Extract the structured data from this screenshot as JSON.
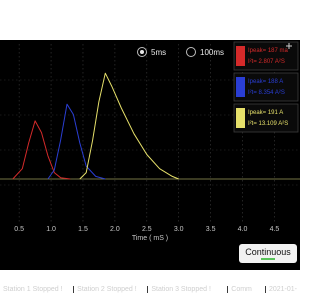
{
  "chart_data": {
    "type": "line",
    "xlabel": "Time ( mS )",
    "ylabel": "",
    "x_ticks": [
      0.5,
      1.0,
      1.5,
      2.0,
      2.5,
      3.0,
      3.5,
      4.0,
      4.5
    ],
    "x_tick_labels": [
      "0.5",
      "1.0",
      "1.5",
      "2.0",
      "2.5",
      "3.0",
      "3.5",
      "4.0",
      "4.5"
    ],
    "xlim": [
      0.2,
      4.9
    ],
    "grid": true,
    "series": [
      {
        "name": "red",
        "color": "#d42a2a",
        "x": [
          0.4,
          0.55,
          0.65,
          0.75,
          0.85,
          0.95,
          1.05,
          1.15,
          1.3
        ],
        "y": [
          0,
          0.08,
          0.28,
          0.45,
          0.36,
          0.18,
          0.05,
          0.01,
          0
        ]
      },
      {
        "name": "blue",
        "color": "#2a3ed4",
        "x": [
          0.95,
          1.05,
          1.15,
          1.25,
          1.35,
          1.45,
          1.55,
          1.7,
          1.85
        ],
        "y": [
          0,
          0.07,
          0.3,
          0.58,
          0.5,
          0.28,
          0.1,
          0.02,
          0
        ]
      },
      {
        "name": "yellow",
        "color": "#e6e06a",
        "x": [
          1.45,
          1.55,
          1.65,
          1.75,
          1.85,
          1.95,
          2.1,
          2.3,
          2.5,
          2.7,
          2.9,
          3.0
        ],
        "y": [
          0,
          0.05,
          0.3,
          0.6,
          0.82,
          0.72,
          0.55,
          0.35,
          0.19,
          0.08,
          0.02,
          0
        ]
      }
    ]
  },
  "timebase": {
    "option_a": "5ms",
    "option_b": "100ms",
    "selected": "5ms"
  },
  "readouts": [
    {
      "color": "#d42a2a",
      "ipeak_label": "Ipeak=",
      "ipeak_value": "187 ma",
      "i2t_label": "I²t=",
      "i2t_value": "2.807 A²S"
    },
    {
      "color": "#2a3ed4",
      "ipeak_label": "Ipeak=",
      "ipeak_value": "188 A",
      "i2t_label": "I²t=",
      "i2t_value": "8.354 A²S"
    },
    {
      "color": "#e6e06a",
      "ipeak_label": "Ipeak=",
      "ipeak_value": "191  A",
      "i2t_label": "I²t=",
      "i2t_value": "13.109 A²S"
    }
  ],
  "continuous_button": "Continuous",
  "status_bar": {
    "station1": "Station 1 Stopped !",
    "station2": "Station 2 Stopped !",
    "station3": "Station 3 Stopped !",
    "comm": "Comm",
    "date": "2021-01-"
  }
}
